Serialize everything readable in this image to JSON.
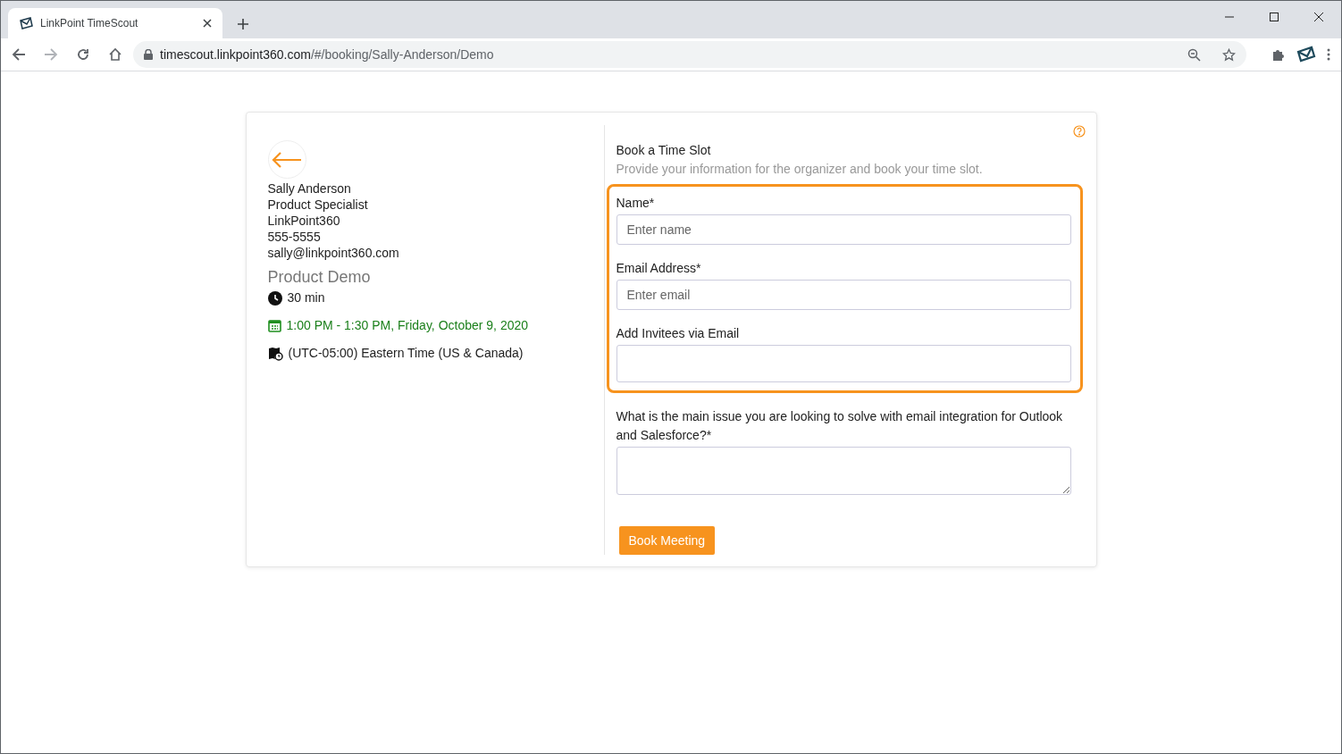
{
  "browser": {
    "tab_title": "LinkPoint TimeScout",
    "url_host": "timescout.linkpoint360.com",
    "url_path": "/#/booking/Sally-Anderson/Demo"
  },
  "organizer": {
    "lines": [
      "Sally Anderson",
      "Product Specialist",
      "LinkPoint360",
      "555-5555",
      "sally@linkpoint360.com"
    ]
  },
  "event": {
    "title": "Product Demo",
    "duration": "30 min",
    "when": "1:00 PM - 1:30 PM, Friday, October 9, 2020",
    "timezone": "(UTC-05:00) Eastern Time (US & Canada)"
  },
  "form": {
    "title": "Book a Time Slot",
    "subtitle": "Provide your information for the organizer and book your time slot.",
    "fields": [
      {
        "kind": "input",
        "label": "Name*",
        "placeholder": "Enter name",
        "highlighted": true
      },
      {
        "kind": "input",
        "label": "Email Address*",
        "placeholder": "Enter email",
        "highlighted": true
      },
      {
        "kind": "tags",
        "label": "Add Invitees via Email",
        "highlighted": true
      },
      {
        "kind": "textarea",
        "label": "What is the main issue you are looking to solve with email integration for Outlook and Salesforce?*",
        "highlighted": false
      }
    ],
    "submit": "Book Meeting"
  }
}
